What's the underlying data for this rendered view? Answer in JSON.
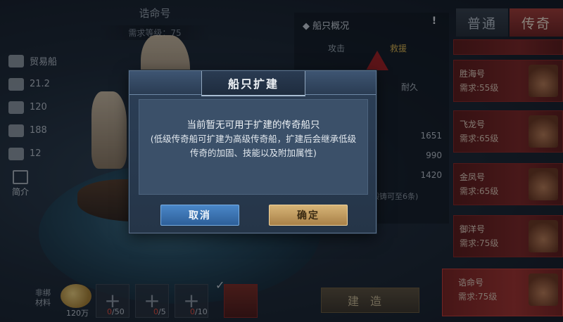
{
  "ship": {
    "title": "诰命号",
    "requirement": "需求等级：75"
  },
  "stats": [
    {
      "icon": "merchant-ship-icon",
      "value": "贸易船"
    },
    {
      "icon": "cannon-icon",
      "value": "21.2"
    },
    {
      "icon": "cargo-icon",
      "value": "120"
    },
    {
      "icon": "sailor-icon",
      "value": "188"
    },
    {
      "icon": "cannonball-icon",
      "value": "12"
    }
  ],
  "intro_label": "简介",
  "overview": {
    "title": "船只概况",
    "help": "!",
    "tabs": [
      {
        "label": "攻击",
        "active": false
      },
      {
        "label": "救援",
        "active": true
      }
    ],
    "durability_label": "耐久",
    "values": [
      "1651",
      "990",
      "1420"
    ],
    "note": "锻铸可至6条)"
  },
  "side_tabs": {
    "normal": "普通",
    "legend": "传奇"
  },
  "ship_list": [
    {
      "name": "",
      "req": ""
    },
    {
      "name": "胜海号",
      "req": "需求:55级"
    },
    {
      "name": "飞龙号",
      "req": "需求:65级"
    },
    {
      "name": "金凤号",
      "req": "需求:65级"
    },
    {
      "name": "御洋号",
      "req": "需求:75级"
    },
    {
      "name": "诰命号",
      "req": "需求:75级"
    }
  ],
  "materials": {
    "label": "非绑材料",
    "coin_amount": "120万",
    "slots": [
      {
        "have": "0",
        "need": "/50"
      },
      {
        "have": "0",
        "need": "/5"
      },
      {
        "have": "0",
        "need": "/10"
      }
    ]
  },
  "build_button": "建造",
  "modal": {
    "title": "船只扩建",
    "message": "当前暂无可用于扩建的传奇船只",
    "detail": "(低级传奇船可扩建为高级传奇船，扩建后会继承低级传奇的加固、技能以及附加属性)",
    "cancel": "取消",
    "confirm": "确定"
  },
  "colors": {
    "modal_bg": "#2c3f57",
    "cancel_blue": "#3b74b3",
    "confirm_gold": "#c49c5e",
    "legend_red": "#8a2420",
    "shortage_red": "#e04a3a"
  }
}
